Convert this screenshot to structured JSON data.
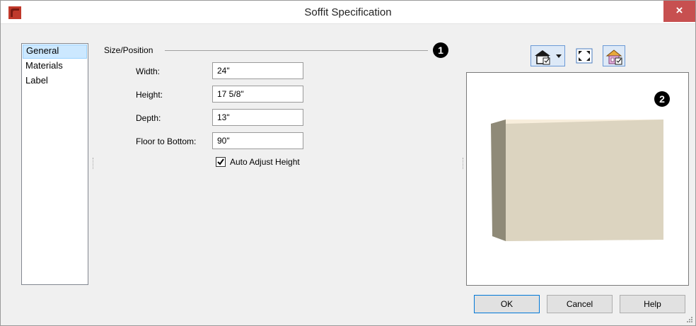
{
  "window": {
    "title": "Soffit Specification",
    "close_glyph": "×"
  },
  "nav": {
    "items": [
      "General",
      "Materials",
      "Label"
    ],
    "selected": "General"
  },
  "size_position": {
    "section_label": "Size/Position",
    "fields": [
      {
        "label": "Width:",
        "value": "24\""
      },
      {
        "label": "Height:",
        "value": "17 5/8\""
      },
      {
        "label": "Depth:",
        "value": "13\""
      },
      {
        "label": "Floor to Bottom:",
        "value": "90\""
      }
    ],
    "auto_adjust": {
      "label": "Auto Adjust Height",
      "checked": true
    }
  },
  "markers": {
    "one": "1",
    "two": "2"
  },
  "toolbar": {
    "icons": [
      "camera-view-icon",
      "chevron-down-icon",
      "fill-window-icon",
      "show-room-icon"
    ]
  },
  "buttons": {
    "ok": "OK",
    "cancel": "Cancel",
    "help": "Help"
  },
  "colors": {
    "accent": "#0078d7",
    "close_bg": "#c75050",
    "box_front": "#dcd4c0",
    "box_top": "#f8eedc",
    "box_side": "#8f8a78"
  }
}
